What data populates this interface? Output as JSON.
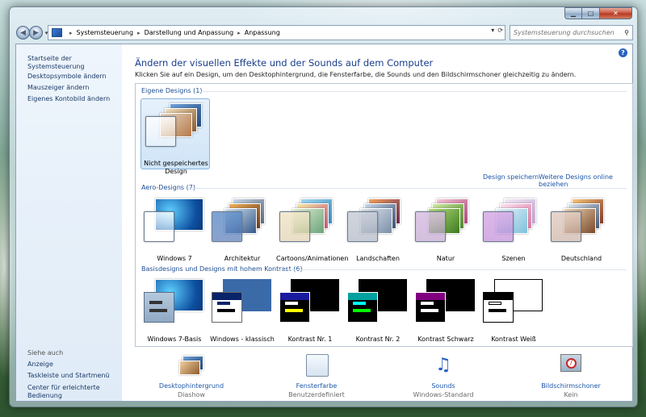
{
  "nav": {
    "breadcrumb": [
      "Systemsteuerung",
      "Darstellung und Anpassung",
      "Anpassung"
    ],
    "search_placeholder": "Systemsteuerung durchsuchen"
  },
  "left_pane": {
    "links": [
      "Startseite der Systemsteuerung",
      "Desktopsymbole ändern",
      "Mauszeiger ändern",
      "Eigenes Kontobild ändern"
    ],
    "see_also_heading": "Siehe auch",
    "see_also": [
      "Anzeige",
      "Taskleiste und Startmenü",
      "Center für erleichterte Bedienung"
    ]
  },
  "main": {
    "title": "Ändern der visuellen Effekte und der Sounds auf dem Computer",
    "description": "Klicken Sie auf ein Design, um den Desktophintergrund, die Fensterfarbe, die Sounds und den Bildschirmschoner gleichzeitig zu ändern."
  },
  "gallery": {
    "my_themes_heading": "Eigene Designs (1)",
    "my_themes": [
      {
        "label_line1": "Nicht gespeichertes",
        "label_line2": "Design"
      }
    ],
    "save_theme": "Design speichern",
    "more_online": "Weitere Designs online beziehen",
    "aero_heading": "Aero-Designs (7)",
    "aero": [
      "Windows 7",
      "Architektur",
      "Cartoons/Animationen",
      "Landschaften",
      "Natur",
      "Szenen",
      "Deutschland"
    ],
    "basic_heading": "Basisdesigns und Designs mit hohem Kontrast (6)",
    "basic": [
      "Windows 7-Basis",
      "Windows - klassisch",
      "Kontrast Nr. 1",
      "Kontrast Nr. 2",
      "Kontrast Schwarz",
      "Kontrast Weiß"
    ]
  },
  "bottom": [
    {
      "title": "Desktophintergrund",
      "sub": "Diashow"
    },
    {
      "title": "Fensterfarbe",
      "sub": "Benutzerdefiniert"
    },
    {
      "title": "Sounds",
      "sub": "Windows-Standard"
    },
    {
      "title": "Bildschirmschoner",
      "sub": "Kein"
    }
  ]
}
